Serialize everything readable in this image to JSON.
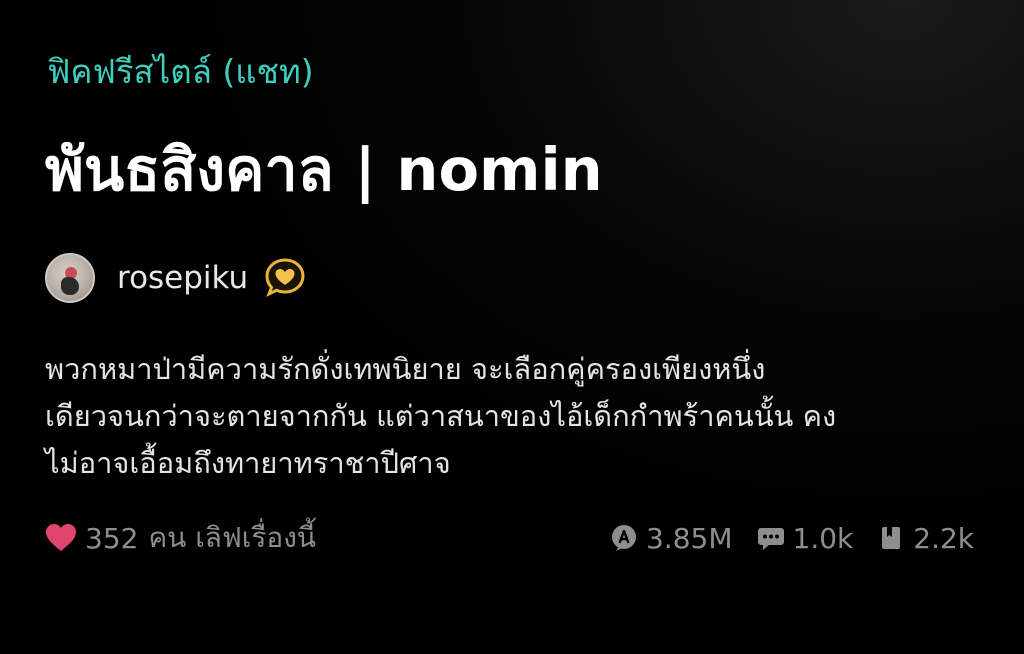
{
  "story": {
    "category": "ฟิคฟรีสไตล์ (แชท)",
    "title": "พันธสิงคาล | nomin",
    "author": {
      "name": "rosepiku",
      "badge_icon": "gold-heart-chat-icon"
    },
    "description_lines": [
      "พวกหมาป่ามีความรักดั่งเทพนิยาย จะเลือกคู่ครองเพียงหนึ่ง",
      "เดียวจนกว่าจะตายจากกัน แต่วาสนาของไอ้เด็กกำพร้าคนนั้น คง",
      "ไม่อาจเอื้อมถึงทายาทราชาปีศาจ"
    ],
    "likes": {
      "icon": "heart-icon",
      "count": "352",
      "label": "คน เลิฟเรื่องนี้"
    },
    "stats": {
      "reads": {
        "icon": "reads-icon",
        "value": "3.85M"
      },
      "comments": {
        "icon": "comment-icon",
        "value": "1.0k"
      },
      "bookmarks": {
        "icon": "bookmark-icon",
        "value": "2.2k"
      }
    }
  },
  "colors": {
    "background": "#000000",
    "category": "#3fcfc0",
    "title": "#ffffff",
    "muted": "#8e8e8e",
    "heart": "#e0456e",
    "badge": "#e8b53a"
  }
}
